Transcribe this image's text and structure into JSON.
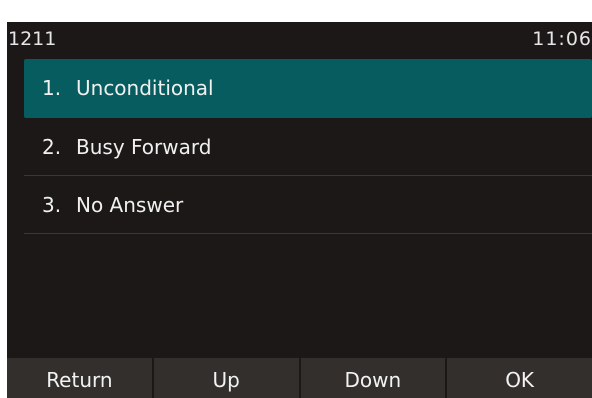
{
  "status_bar": {
    "account": "1211",
    "time": "11:06"
  },
  "menu": {
    "items": [
      {
        "number": "1.",
        "label": "Unconditional",
        "selected": true
      },
      {
        "number": "2.",
        "label": "Busy Forward",
        "selected": false
      },
      {
        "number": "3.",
        "label": "No Answer",
        "selected": false
      }
    ]
  },
  "softkeys": {
    "return_label": "Return",
    "up_label": "Up",
    "down_label": "Down",
    "ok_label": "OK"
  },
  "colors": {
    "background": "#1b1817",
    "highlight": "#065c5e",
    "softkey_bar": "#322f2d",
    "text": "#f0f0f0"
  }
}
